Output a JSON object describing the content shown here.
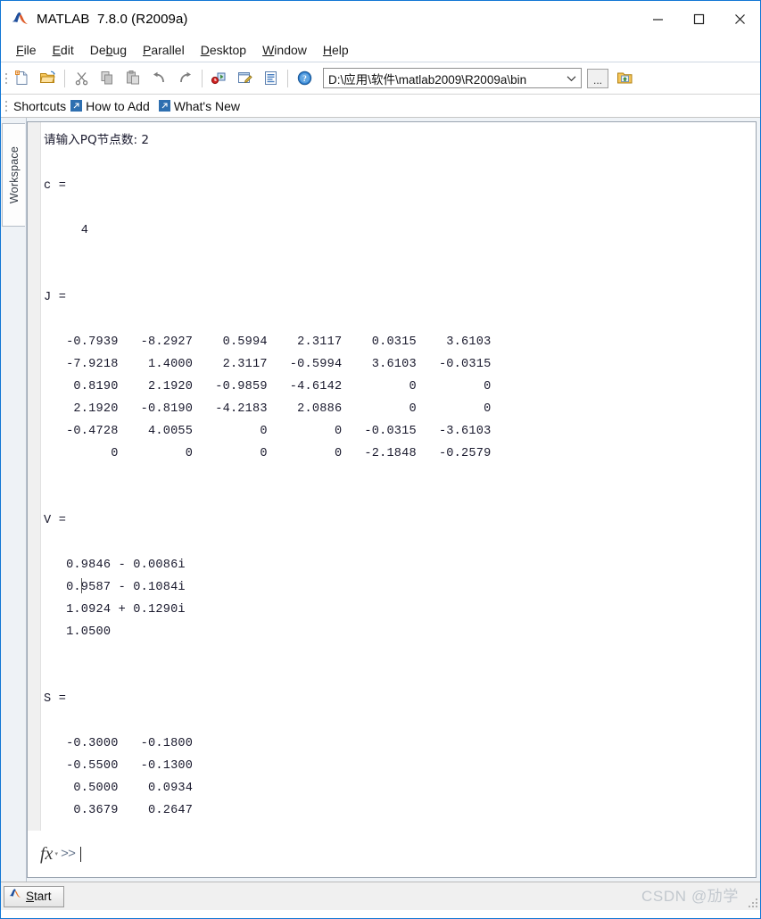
{
  "window": {
    "title": "MATLAB  7.8.0 (R2009a)",
    "logo_icon": "matlab-membrane-icon",
    "minimize_icon": "minimize-icon",
    "maximize_icon": "maximize-icon",
    "close_icon": "close-icon"
  },
  "menubar": {
    "items": [
      {
        "label": "File",
        "mnemonic": "F"
      },
      {
        "label": "Edit",
        "mnemonic": "E"
      },
      {
        "label": "Debug",
        "mnemonic": "b"
      },
      {
        "label": "Parallel",
        "mnemonic": "P"
      },
      {
        "label": "Desktop",
        "mnemonic": "D"
      },
      {
        "label": "Window",
        "mnemonic": "W"
      },
      {
        "label": "Help",
        "mnemonic": "H"
      }
    ]
  },
  "toolbar": {
    "buttons": [
      {
        "name": "new-file-icon",
        "tooltip": "New"
      },
      {
        "name": "open-folder-icon",
        "tooltip": "Open"
      },
      {
        "name": "cut-scissors-icon",
        "tooltip": "Cut"
      },
      {
        "name": "copy-icon",
        "tooltip": "Copy"
      },
      {
        "name": "paste-icon",
        "tooltip": "Paste"
      },
      {
        "name": "undo-arrow-icon",
        "tooltip": "Undo"
      },
      {
        "name": "redo-arrow-icon",
        "tooltip": "Redo"
      },
      {
        "name": "simulink-icon",
        "tooltip": "Simulink Library"
      },
      {
        "name": "guide-icon",
        "tooltip": "GUIDE"
      },
      {
        "name": "profiler-icon",
        "tooltip": "Profiler"
      },
      {
        "name": "help-question-icon",
        "tooltip": "Help"
      }
    ],
    "path": {
      "value": "D:\\应用\\软件\\matlab2009\\R2009a\\bin",
      "dropdown_icon": "chevron-down-icon",
      "browse_label": "...",
      "up_folder_icon": "up-one-level-folder-icon"
    }
  },
  "shortcuts_bar": {
    "label": "Shortcuts",
    "links": [
      {
        "label": "How to Add",
        "icon": "shortcut-arrow-icon"
      },
      {
        "label": "What's New",
        "icon": "shortcut-arrow-icon"
      }
    ]
  },
  "sidebar": {
    "workspace_tab": "Workspace"
  },
  "console": {
    "lines": [
      {
        "text": "请输入PQ节点数: 2",
        "cjk": true
      },
      {
        "text": ""
      },
      {
        "text": "c ="
      },
      {
        "text": ""
      },
      {
        "text": "     4"
      },
      {
        "text": ""
      },
      {
        "text": ""
      },
      {
        "text": "J ="
      },
      {
        "text": ""
      },
      {
        "text": "   -0.7939   -8.2927    0.5994    2.3117    0.0315    3.6103"
      },
      {
        "text": "   -7.9218    1.4000    2.3117   -0.5994    3.6103   -0.0315"
      },
      {
        "text": "    0.8190    2.1920   -0.9859   -4.6142         0         0"
      },
      {
        "text": "    2.1920   -0.8190   -4.2183    2.0886         0         0"
      },
      {
        "text": "   -0.4728    4.0055         0         0   -0.0315   -3.6103"
      },
      {
        "text": "         0         0         0         0   -2.1848   -0.2579"
      },
      {
        "text": ""
      },
      {
        "text": ""
      },
      {
        "text": "V ="
      },
      {
        "text": ""
      },
      {
        "text": "   0.9846 - 0.0086i"
      },
      {
        "text": "   0.9587 - 0.1084i"
      },
      {
        "text": "   1.0924 + 0.1290i"
      },
      {
        "text": "   1.0500"
      },
      {
        "text": ""
      },
      {
        "text": ""
      },
      {
        "text": "S ="
      },
      {
        "text": ""
      },
      {
        "text": "   -0.3000   -0.1800"
      },
      {
        "text": "   -0.5500   -0.1300"
      },
      {
        "text": "    0.5000    0.0934"
      },
      {
        "text": "    0.3679    0.2647"
      }
    ],
    "full_text": "请输入PQ节点数: 2\n\nc =\n\n     4\n\n\nJ =\n\n   -0.7939   -8.2927    0.5994    2.3117    0.0315    3.6103\n   -7.9218    1.4000    2.3117   -0.5994    3.6103   -0.0315\n    0.8190    2.1920   -0.9859   -4.6142         0         0\n    2.1920   -0.8190   -4.2183    2.0886         0         0\n   -0.4728    4.0055         0         0   -0.0315   -3.6103\n         0         0         0         0   -2.1848   -0.2579\n\n\nV =\n\n   0.9846 - 0.0086i\n   0.9587 - 0.1084i\n   1.0924 + 0.1290i\n   1.0500\n\n\nS =\n\n   -0.3000   -0.1800\n   -0.5500   -0.1300\n    0.5000    0.0934\n    0.3679    0.2647",
    "prompt": ">>",
    "fx_label": "fx",
    "input_value": ""
  },
  "statusbar": {
    "start_label": "Start",
    "start_mnemonic": "S",
    "start_icon": "matlab-membrane-icon",
    "watermark": "CSDN @劢学"
  }
}
